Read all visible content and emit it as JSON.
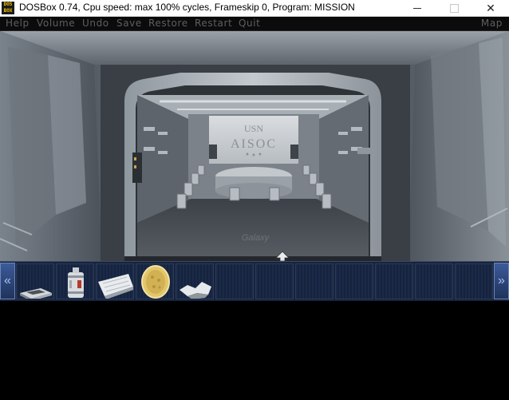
{
  "window": {
    "app_icon_text": "DOS\nBOX",
    "title": "DOSBox 0.74, Cpu speed: max 100% cycles, Frameskip  0, Program:  MISSION",
    "controls": {
      "minimize": "minimize-icon",
      "maximize": "maximize-icon",
      "close": "close-icon"
    }
  },
  "menubar": {
    "items": [
      "Help",
      "Volume",
      "Undo",
      "Save",
      "Restore",
      "Restart",
      "Quit"
    ],
    "map": "Map"
  },
  "scene": {
    "sign_line1": "USN",
    "sign_line2": "AISOC",
    "floor_text": "Galaxy"
  },
  "inventory": {
    "left_scroll": "«",
    "right_scroll": "»",
    "items": [
      "device-item",
      "canister-item",
      "paper-item",
      "gold-disk-item",
      "torn-paper-item"
    ],
    "empty_slots": 7
  },
  "colors": {
    "menu_text": "#5f5f5f",
    "inventory_bg": "#16233d",
    "scroll_button": "#3c5b99"
  }
}
